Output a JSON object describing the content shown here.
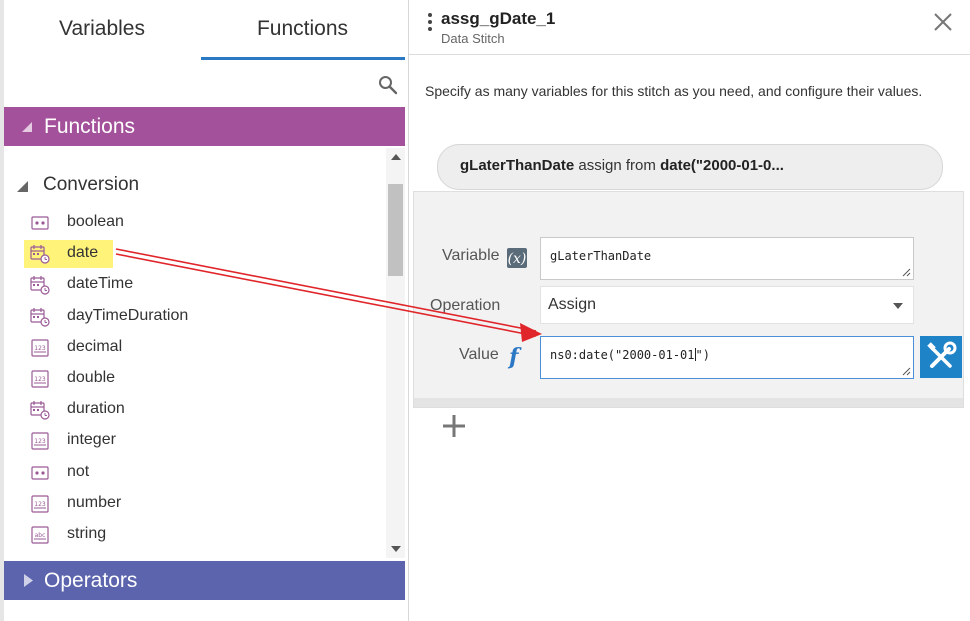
{
  "tabs": {
    "variables": "Variables",
    "functions": "Functions"
  },
  "functions_header": "Functions",
  "category": "Conversion",
  "functions": [
    {
      "label": "boolean",
      "icon": "boolean-icon"
    },
    {
      "label": "date",
      "icon": "calendar-clock-icon"
    },
    {
      "label": "dateTime",
      "icon": "calendar-clock-icon"
    },
    {
      "label": "dayTimeDuration",
      "icon": "calendar-clock-icon"
    },
    {
      "label": "decimal",
      "icon": "number-123-icon"
    },
    {
      "label": "double",
      "icon": "number-123-icon"
    },
    {
      "label": "duration",
      "icon": "calendar-clock-icon"
    },
    {
      "label": "integer",
      "icon": "number-123-icon"
    },
    {
      "label": "not",
      "icon": "boolean-icon"
    },
    {
      "label": "number",
      "icon": "number-123-icon"
    },
    {
      "label": "string",
      "icon": "text-abc-icon"
    }
  ],
  "operators_header": "Operators",
  "stitch": {
    "title": "assg_gDate_1",
    "subtitle": "Data Stitch"
  },
  "description": "Specify as many variables for this stitch as you need, and configure their values.",
  "assignment": {
    "variable": "gLaterThanDate",
    "connector": "assign from",
    "expression": "date(\"2000-01-0..."
  },
  "editor": {
    "variable_label": "Variable",
    "operation_label": "Operation",
    "value_label": "Value",
    "variable_value": "gLaterThanDate",
    "operation_value": "Assign",
    "value_before_cursor": "ns0:date(\"2000-01-01",
    "value_after_cursor": "\")"
  },
  "colors": {
    "functions_header": "#a4519b",
    "operators_header": "#5b64ad",
    "tab_underline": "#2b78c4",
    "highlight": "#fff37a",
    "tools_button": "#1f83c8",
    "arrow": "#e0262b"
  }
}
